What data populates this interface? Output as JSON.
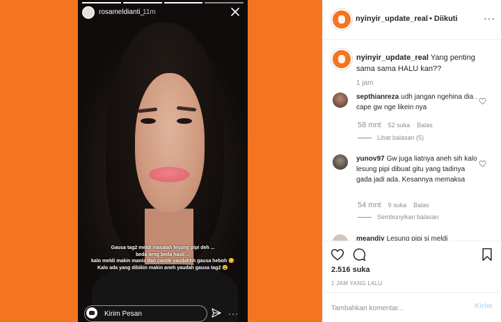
{
  "story": {
    "username": "rosameldianti_",
    "time": "11m",
    "caption_lines": [
      "Gausa tag2 meldi masalah lesung pipi deh ...",
      "beda orng beda hasil ...",
      "kalo meldi makin manis dan cantik yaudahhh gausa heboh 😋",
      "Kalo ada yang dibikin makin aneh yaudah gausa tag2 😩"
    ],
    "reply_placeholder": "Kirim Pesan",
    "icons": {
      "close": "close-icon",
      "camera": "camera-icon",
      "send": "send-icon",
      "more": "more-icon"
    },
    "progress_segments": 4
  },
  "post": {
    "header": {
      "username": "nyinyir_update_real",
      "follow_status": "• Diikuti",
      "more": "···"
    },
    "caption": {
      "username": "nyinyir_update_real",
      "text": "Yang penting sama sama HALU kan??",
      "time": "1 jam"
    },
    "comments": [
      {
        "username": "septhianreza",
        "text": "udh jangan ngehina dia . cape gw nge likein nya",
        "time": "58 mnt",
        "likes": "52 suka",
        "reply_label": "Balas",
        "replies_toggle": "Lihat balasan (5)"
      },
      {
        "username": "yunov97",
        "text": "Gw juga liatnya aneh sih kalo lesung pipi dibuat gitu yang tadinya gada jadi ada. Kesannya memaksa",
        "time": "54 mnt",
        "likes": "9 suka",
        "reply_label": "Balas",
        "replies_toggle": "Sembunyikan balasan"
      },
      {
        "username": "meandiy",
        "text": "Lesung pipi si meldi"
      }
    ],
    "likes_count": "2.516 suka",
    "posted_time": "1 JAM YANG LALU",
    "comment_placeholder": "Tambahkan komentar...",
    "post_button": "Kirim"
  },
  "colors": {
    "background_orange": "#f5741f",
    "link_blue": "#b2dffc",
    "muted": "#8e8e8e"
  }
}
